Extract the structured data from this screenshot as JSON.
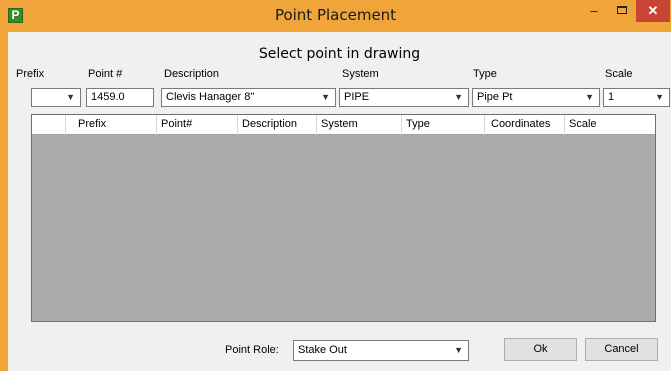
{
  "window": {
    "title": "Point Placement",
    "app_icon_letter": "P",
    "controls": {
      "minimize": "–",
      "close": "✕"
    }
  },
  "instruction": "Select point in drawing",
  "fields": {
    "prefix": {
      "label": "Prefix",
      "value": ""
    },
    "point_number": {
      "label": "Point #",
      "value": "1459.0"
    },
    "description": {
      "label": "Description",
      "value": "Clevis Hanager 8\""
    },
    "system": {
      "label": "System",
      "value": "PIPE"
    },
    "type": {
      "label": "Type",
      "value": "Pipe Pt"
    },
    "scale": {
      "label": "Scale",
      "value": "1"
    }
  },
  "grid": {
    "columns": [
      "",
      "Prefix",
      "Point#",
      "Description",
      "System",
      "Type",
      "Coordinates",
      "Scale"
    ],
    "rows": []
  },
  "point_role": {
    "label": "Point Role:",
    "value": "Stake Out"
  },
  "buttons": {
    "ok": "Ok",
    "cancel": "Cancel"
  },
  "icons": {
    "dropdown": "chevron-down-icon"
  },
  "colors": {
    "titlebar": "#f0a53a",
    "close": "#c84434",
    "grid_background": "#ababab"
  }
}
